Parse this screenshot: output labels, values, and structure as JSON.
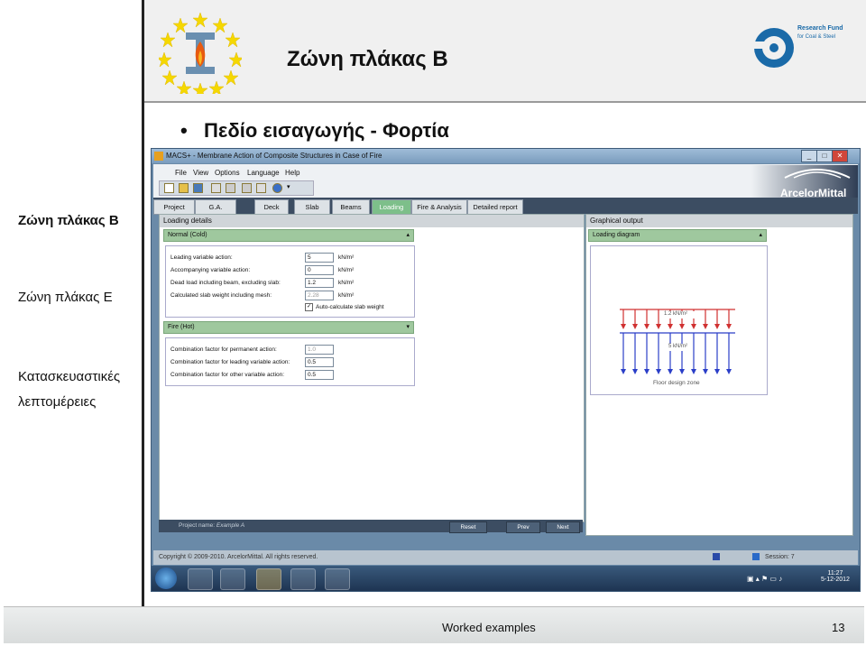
{
  "slide": {
    "title": "Ζώνη πλάκας Β",
    "bullet": "Πεδίο εισαγωγής - Φορτία",
    "side_items": [
      "Ζώνη πλάκας Β",
      "Ζώνη πλάκας Ε",
      "Κατασκευαστικές",
      "λεπτομέρειες"
    ],
    "footer": "Worked examples",
    "page": "13",
    "logo_text_line1": "Research Fund",
    "logo_text_line2": "for Coal & Steel"
  },
  "app": {
    "title": "MACS+ - Membrane Action of Composite Structures in Case of Fire",
    "menu": [
      "File",
      "View",
      "Options",
      "Language",
      "Help"
    ],
    "brand": "ArcelorMittal",
    "tabs": [
      "Project",
      "G.A.",
      "Deck",
      "Slab",
      "Beams",
      "Loading",
      "Fire & Analysis",
      "Detailed report"
    ],
    "left_header": "Loading details",
    "right_header": "Graphical output",
    "cold_group": "Normal (Cold)",
    "cold_fields": [
      {
        "label": "Leading variable action:",
        "value": "5",
        "unit": "kN/m²"
      },
      {
        "label": "Accompanying variable action:",
        "value": "0",
        "unit": "kN/m²"
      },
      {
        "label": "Dead load including beam, excluding slab:",
        "value": "1.2",
        "unit": "kN/m²"
      },
      {
        "label": "Calculated slab weight including mesh:",
        "value": "2.28",
        "unit": "kN/m²"
      }
    ],
    "auto_calc": "Auto-calculate slab weight",
    "fire_group": "Fire (Hot)",
    "fire_fields": [
      {
        "label": "Combination factor for permanent action:",
        "value": "1.0"
      },
      {
        "label": "Combination factor for leading variable action:",
        "value": "0.5"
      },
      {
        "label": "Combination factor for other variable action:",
        "value": "0.5"
      }
    ],
    "diagram_group": "Loading diagram",
    "diagram_top_load": "1.2 kN/m²",
    "diagram_bottom_load": "5 kN/m²",
    "diagram_caption": "Floor design zone",
    "project_label": "Project name:",
    "project_name": "Example A",
    "buttons": {
      "reset": "Reset",
      "prev": "Prev",
      "next": "Next"
    },
    "copyright": "Copyright © 2009-2010. ArcelorMittal. All rights reserved.",
    "session": "Session: 7",
    "clock_time": "11:27",
    "clock_date": "5-12-2012"
  }
}
